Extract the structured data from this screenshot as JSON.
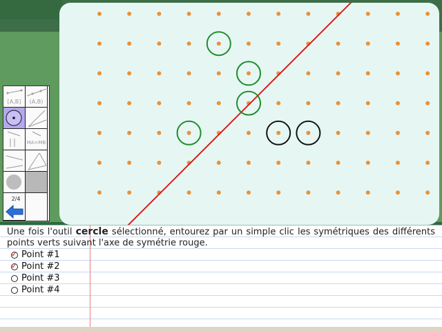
{
  "instruction": {
    "before": "Une fois l'outil ",
    "keyword": "cercle",
    "after": " sélectionné, entourez par un simple clic les symétriques des différents points verts suivant l'axe de symétrie rouge."
  },
  "options": [
    {
      "label": "Point #1",
      "checked": true
    },
    {
      "label": "Point #2",
      "checked": true
    },
    {
      "label": "Point #3",
      "checked": false
    },
    {
      "label": "Point #4",
      "checked": false
    }
  ],
  "toolbar": {
    "tools": [
      {
        "name": "segment-tool",
        "label": "[A,B]"
      },
      {
        "name": "line-tool",
        "label": "(A,B)"
      },
      {
        "name": "circle-tool",
        "label": "",
        "selected": true
      },
      {
        "name": "ray-tool",
        "label": ""
      },
      {
        "name": "parallel-tool",
        "label": "∥"
      },
      {
        "name": "midpoint-tool",
        "label": "MA=MB"
      },
      {
        "name": "perpendicular-tool",
        "label": ""
      },
      {
        "name": "polygon-tool",
        "label": ""
      },
      {
        "name": "fill-gray-tool",
        "label": ""
      },
      {
        "name": "fill-dark-tool",
        "label": ""
      },
      {
        "name": "undo-tool",
        "label": ""
      },
      {
        "name": "empty-tool",
        "label": ""
      }
    ],
    "counter": "2/4"
  },
  "grid": {
    "dot_color": "#e8923a",
    "axis_color": "#e01818",
    "green_color": "#1e8c2a",
    "black_color": "#111111"
  }
}
